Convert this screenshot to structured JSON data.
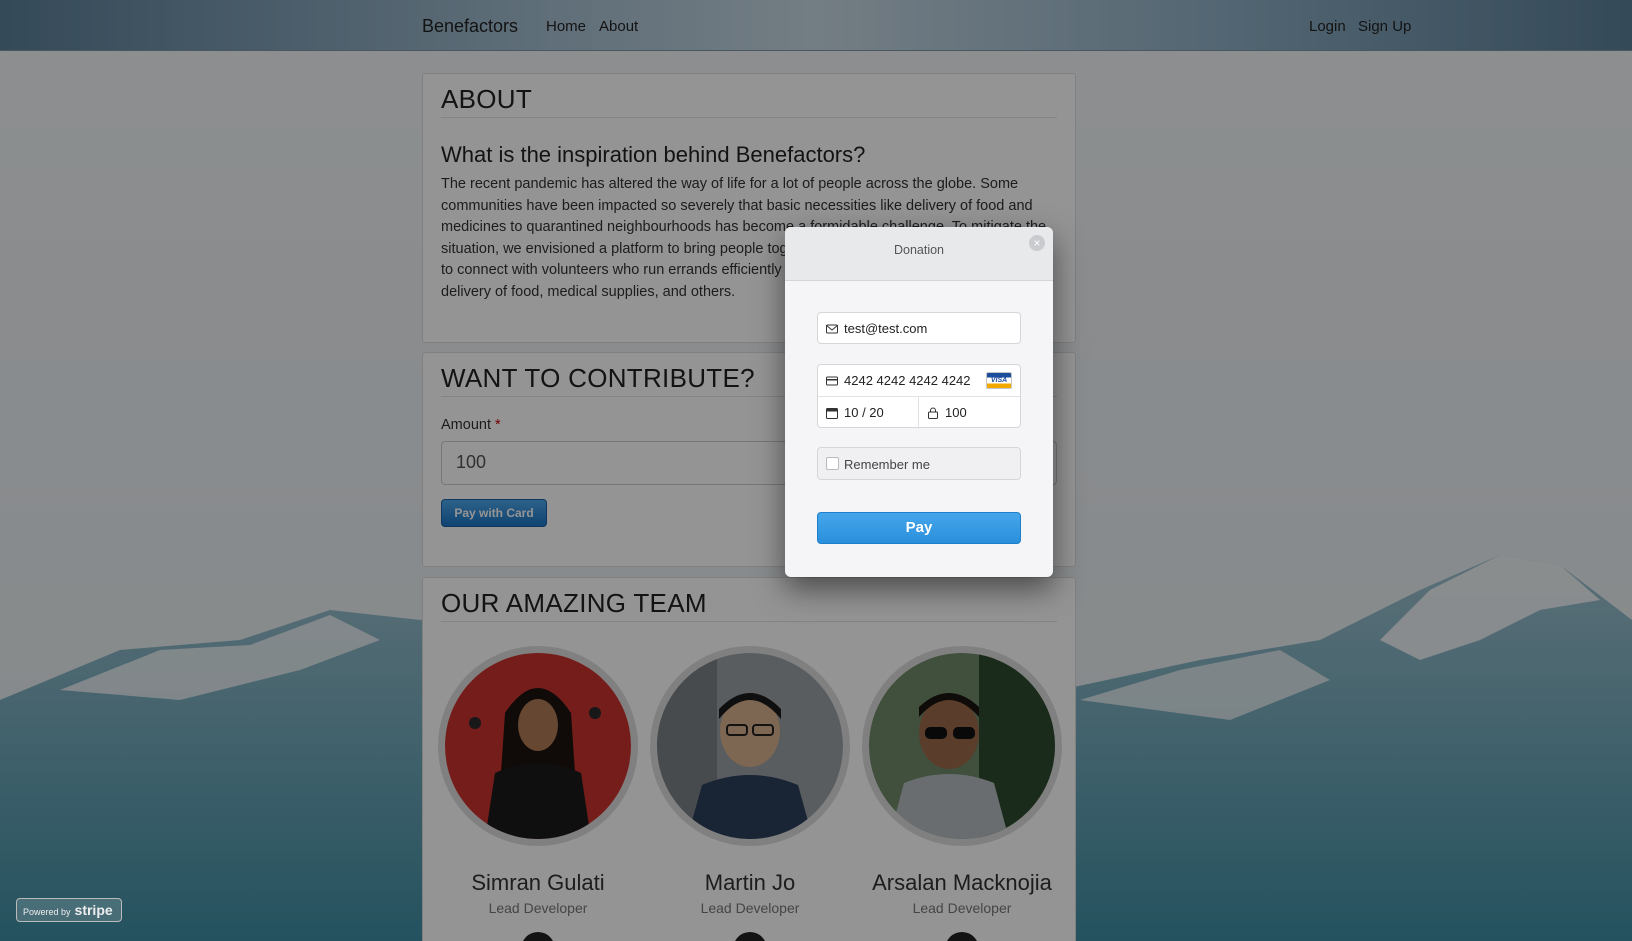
{
  "nav": {
    "brand": "Benefactors",
    "links": [
      "Home",
      "About"
    ],
    "right_links": [
      "Login",
      "Sign Up"
    ]
  },
  "about": {
    "heading": "ABOUT",
    "subheading": "What is the inspiration behind Benefactors?",
    "paragraph": "The recent pandemic has altered the way of life for a lot of people across the globe. Some communities have been impacted so severely that basic necessities like delivery of food and medicines to quarantined neighbourhoods has become a formidable challenge. To mitigate the situation, we envisioned a platform to bring people together. Benefactors allows people in need to connect with volunteers who run errands efficiently and at no cost. Expected services include delivery of food, medical supplies, and others."
  },
  "contribute": {
    "heading": "WANT TO CONTRIBUTE?",
    "amount_label": "Amount",
    "required_mark": "*",
    "amount_value": "100",
    "pay_button": "Pay with Card"
  },
  "team": {
    "heading": "OUR AMAZING TEAM",
    "members": [
      {
        "name": "Simran Gulati",
        "role": "Lead Developer",
        "icon": "linkedin-icon"
      },
      {
        "name": "Martin Jo",
        "role": "Lead Developer",
        "icon": "linkedin-icon"
      },
      {
        "name": "Arsalan Macknojia",
        "role": "Lead Developer",
        "icon": "linkedin-icon"
      }
    ]
  },
  "modal": {
    "title": "Donation",
    "close_icon": "close-icon",
    "email": "test@test.com",
    "card_number": "4242 4242 4242 4242",
    "card_brand": "VISA",
    "expiry": "10 / 20",
    "cvc": "100",
    "remember_label": "Remember me",
    "pay_button": "Pay"
  },
  "footer": {
    "stripe_prefix": "Powered by",
    "stripe_brand": "stripe"
  },
  "colors": {
    "accent": "#2a8fdc",
    "overlay": "rgba(0,0,0,0.42)",
    "required": "#cc0000"
  }
}
